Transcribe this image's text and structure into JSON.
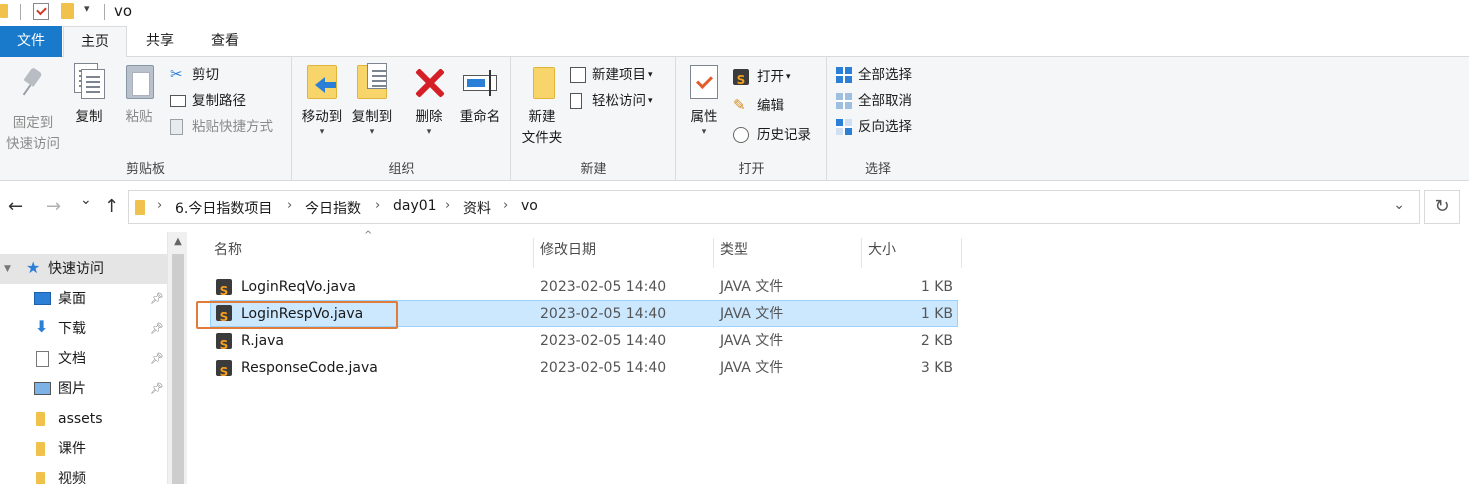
{
  "window": {
    "title": "vo",
    "quick_access_dropdown": "▾"
  },
  "ribbon_tabs": [
    {
      "label": "文件"
    },
    {
      "label": "主页"
    },
    {
      "label": "共享"
    },
    {
      "label": "查看"
    }
  ],
  "ribbon": {
    "clipboard": {
      "group_label": "剪贴板",
      "pin_label_line1": "固定到",
      "pin_label_line2": "快速访问",
      "copy_label": "复制",
      "paste_label": "粘贴",
      "cut_label": "剪切",
      "copy_path_label": "复制路径",
      "paste_shortcut_label": "粘贴快捷方式"
    },
    "organize": {
      "group_label": "组织",
      "move_to_label": "移动到",
      "copy_to_label": "复制到",
      "delete_label": "删除",
      "rename_label": "重命名"
    },
    "new": {
      "group_label": "新建",
      "new_folder_line1": "新建",
      "new_folder_line2": "文件夹",
      "new_item_label": "新建项目",
      "easy_access_label": "轻松访问"
    },
    "open": {
      "group_label": "打开",
      "properties_label": "属性",
      "open_label": "打开",
      "edit_label": "编辑",
      "history_label": "历史记录"
    },
    "select": {
      "group_label": "选择",
      "select_all_label": "全部选择",
      "select_none_label": "全部取消",
      "invert_selection_label": "反向选择"
    }
  },
  "navigation": {
    "back_glyph": "←",
    "forward_glyph": "→",
    "recent_glyph": "⌄",
    "up_glyph": "↑",
    "refresh_glyph": "↻",
    "address_dropdown_glyph": "⌄",
    "breadcrumb_separator": "›",
    "breadcrumbs": [
      "6.今日指数项目",
      "今日指数",
      "day01",
      "资料",
      "vo"
    ]
  },
  "nav_pane": {
    "quick_access_label": "快速访问",
    "items": [
      {
        "label": "桌面",
        "icon": "desktop-icon",
        "pinned": true
      },
      {
        "label": "下载",
        "icon": "download-icon",
        "pinned": true
      },
      {
        "label": "文档",
        "icon": "documents-icon",
        "pinned": true
      },
      {
        "label": "图片",
        "icon": "pictures-icon",
        "pinned": true
      },
      {
        "label": "assets",
        "icon": "folder-icon",
        "pinned": false
      },
      {
        "label": "课件",
        "icon": "folder-icon",
        "pinned": false
      },
      {
        "label": "视频",
        "icon": "folder-icon",
        "pinned": false
      }
    ]
  },
  "file_list": {
    "columns": {
      "name": "名称",
      "date": "修改日期",
      "type": "类型",
      "size": "大小"
    },
    "files": [
      {
        "name": "LoginReqVo.java",
        "date": "2023-02-05 14:40",
        "type": "JAVA 文件",
        "size": "1 KB",
        "selected": false
      },
      {
        "name": "LoginRespVo.java",
        "date": "2023-02-05 14:40",
        "type": "JAVA 文件",
        "size": "1 KB",
        "selected": true
      },
      {
        "name": "R.java",
        "date": "2023-02-05 14:40",
        "type": "JAVA 文件",
        "size": "2 KB",
        "selected": false
      },
      {
        "name": "ResponseCode.java",
        "date": "2023-02-05 14:40",
        "type": "JAVA 文件",
        "size": "3 KB",
        "selected": false
      }
    ]
  },
  "colors": {
    "file_tab": "#1979ca",
    "selection_bg": "#cce8ff",
    "highlight_border": "#e07b39"
  }
}
